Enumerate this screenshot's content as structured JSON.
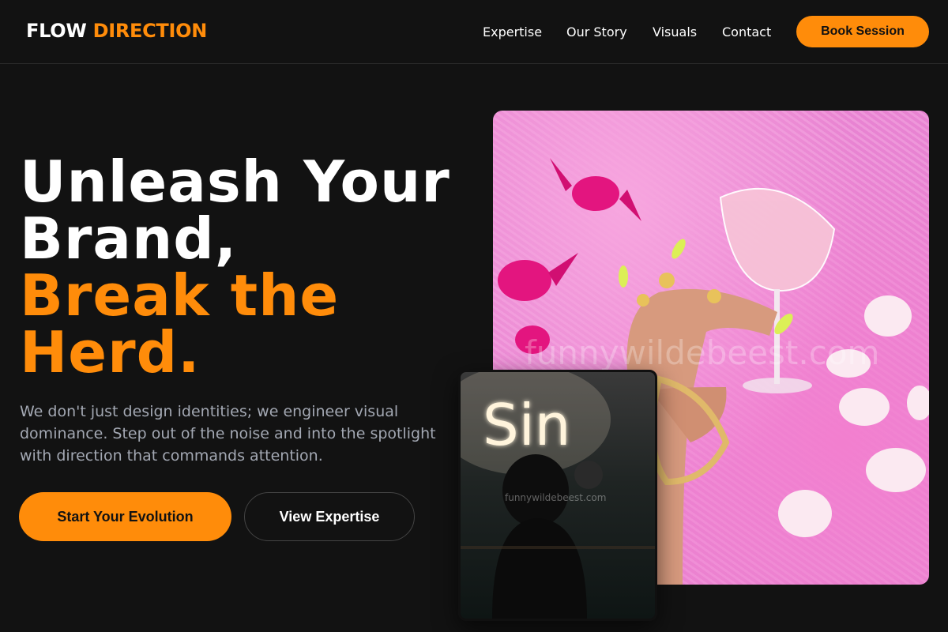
{
  "brand": {
    "name_part1": "FLOW",
    "name_part2": "DIRECTION"
  },
  "nav": {
    "links": [
      {
        "label": "Expertise"
      },
      {
        "label": "Our Story"
      },
      {
        "label": "Visuals"
      },
      {
        "label": "Contact"
      }
    ],
    "cta_label": "Book Session"
  },
  "hero": {
    "headline_line1": "Unleash Your",
    "headline_line2": "Brand,",
    "headline_line3": "Break the",
    "headline_line4": "Herd.",
    "subtext": "We don't just design identities; we engineer visual dominance. Step out of the noise and into the spotlight with direction that commands attention.",
    "primary_button": "Start Your Evolution",
    "secondary_button": "View Expertise"
  },
  "images": {
    "main_watermark": "funnywildebeest.com",
    "small_watermark": "funnywildebeest.com",
    "neon_sign_text": "Sin"
  },
  "colors": {
    "accent": "#ff8c0a",
    "background": "#121212",
    "muted_text": "#a3a8b3"
  }
}
